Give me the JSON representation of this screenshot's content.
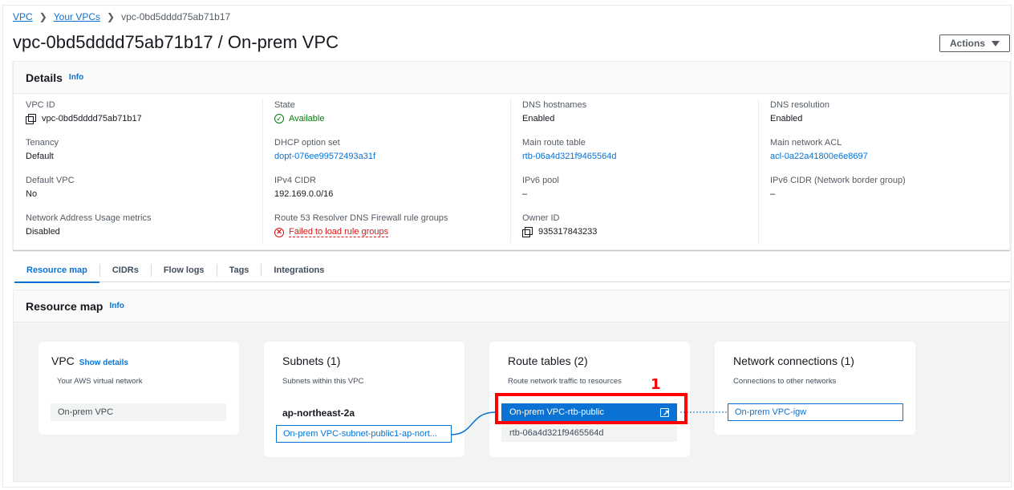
{
  "breadcrumb": {
    "items": [
      "VPC",
      "Your VPCs"
    ],
    "current": "vpc-0bd5dddd75ab71b17"
  },
  "page": {
    "title": "vpc-0bd5dddd75ab71b17 / On-prem VPC",
    "actions_label": "Actions"
  },
  "details": {
    "title": "Details",
    "info": "Info",
    "fields": {
      "vpc_id": {
        "label": "VPC ID",
        "value": "vpc-0bd5dddd75ab71b17"
      },
      "tenancy": {
        "label": "Tenancy",
        "value": "Default"
      },
      "default_vpc": {
        "label": "Default VPC",
        "value": "No"
      },
      "nau_metrics": {
        "label": "Network Address Usage metrics",
        "value": "Disabled"
      },
      "state": {
        "label": "State",
        "value": "Available"
      },
      "dhcp": {
        "label": "DHCP option set",
        "value": "dopt-076ee99572493a31f"
      },
      "ipv4_cidr": {
        "label": "IPv4 CIDR",
        "value": "192.169.0.0/16"
      },
      "r53": {
        "label": "Route 53 Resolver DNS Firewall rule groups",
        "value": "Failed to load rule groups"
      },
      "dns_hostnames": {
        "label": "DNS hostnames",
        "value": "Enabled"
      },
      "main_rt": {
        "label": "Main route table",
        "value": "rtb-06a4d321f9465564d"
      },
      "ipv6_pool": {
        "label": "IPv6 pool",
        "value": "–"
      },
      "owner_id": {
        "label": "Owner ID",
        "value": "935317843233"
      },
      "dns_resolution": {
        "label": "DNS resolution",
        "value": "Enabled"
      },
      "main_acl": {
        "label": "Main network ACL",
        "value": "acl-0a22a41800e6e8697"
      },
      "ipv6_cidr": {
        "label": "IPv6 CIDR (Network border group)",
        "value": "–"
      }
    }
  },
  "tabs": [
    "Resource map",
    "CIDRs",
    "Flow logs",
    "Tags",
    "Integrations"
  ],
  "resource_map": {
    "title": "Resource map",
    "info": "Info",
    "vpc_card": {
      "title": "VPC",
      "show_details": "Show details",
      "subtitle": "Your AWS virtual network",
      "item": "On-prem VPC"
    },
    "subnets_card": {
      "title": "Subnets (1)",
      "subtitle": "Subnets within this VPC",
      "az": "ap-northeast-2a",
      "item": "On-prem VPC-subnet-public1-ap-nort..."
    },
    "rt_card": {
      "title": "Route tables (2)",
      "subtitle": "Route network traffic to resources",
      "selected": "On-prem VPC-rtb-public",
      "other": "rtb-06a4d321f9465564d"
    },
    "nc_card": {
      "title": "Network connections (1)",
      "subtitle": "Connections to other networks",
      "item": "On-prem VPC-igw"
    }
  },
  "annotation": {
    "number": "1",
    "color": "#ff0000"
  },
  "colors": {
    "link": "#0972d3",
    "success": "#037f0c",
    "error": "#d91515"
  },
  "icons": [
    "chevron-right-icon",
    "caret-down-icon",
    "copy-icon",
    "check-circle-icon",
    "error-circle-icon",
    "external-link-icon"
  ]
}
